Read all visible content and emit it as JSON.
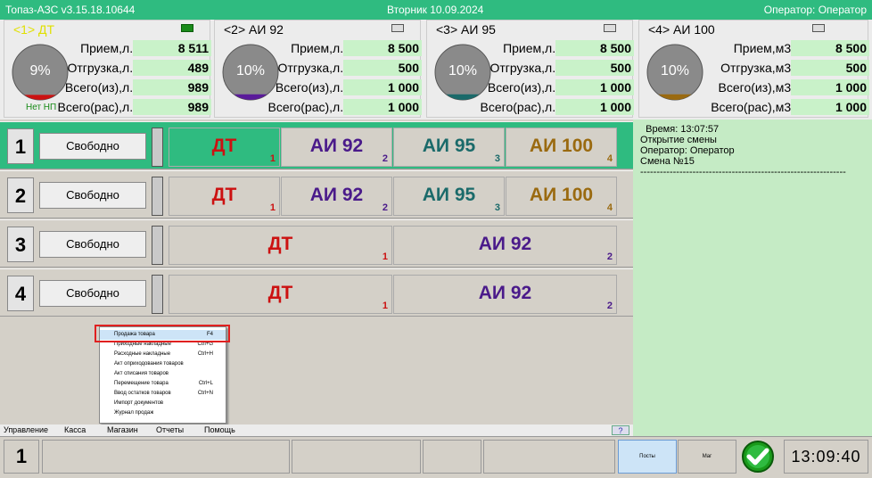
{
  "titlebar": {
    "app": "Топаз-АЗС  v3.15.18.10644",
    "date": "Вторник 10.09.2024",
    "operator": "Оператор: Оператор"
  },
  "tanks": [
    {
      "name": "<1> ДТ",
      "name_color": "#e0e000",
      "indicator_on": true,
      "percent": "9%",
      "fill": 0.09,
      "fill_color": "#cc1111",
      "nonp": "Нет НП",
      "labels": [
        "Прием,л.:",
        "Отгрузка,л.:",
        "Всего(из),л.:",
        "Всего(рас),л.:"
      ],
      "values": [
        "8 511",
        "489",
        "989",
        "989"
      ]
    },
    {
      "name": "<2> АИ 92",
      "name_color": "#000000",
      "indicator_on": false,
      "percent": "10%",
      "fill": 0.1,
      "fill_color": "#5a1a9a",
      "nonp": "",
      "labels": [
        "Прием,л.:",
        "Отгрузка,л.:",
        "Всего(из),л.:",
        "Всего(рас),л.:"
      ],
      "values": [
        "8 500",
        "500",
        "1 000",
        "1 000"
      ]
    },
    {
      "name": "<3> АИ 95",
      "name_color": "#000000",
      "indicator_on": false,
      "percent": "10%",
      "fill": 0.1,
      "fill_color": "#1a6a6a",
      "nonp": "",
      "labels": [
        "Прием,л.:",
        "Отгрузка,л.:",
        "Всего(из),л.:",
        "Всего(рас),л.:"
      ],
      "values": [
        "8 500",
        "500",
        "1 000",
        "1 000"
      ]
    },
    {
      "name": "<4> АИ 100",
      "name_color": "#000000",
      "indicator_on": false,
      "percent": "10%",
      "fill": 0.1,
      "fill_color": "#9a6a10",
      "nonp": "",
      "labels": [
        "Прием,м3:",
        "Отгрузка,м3:",
        "Всего(из),м3:",
        "Всего(рас),м3:"
      ],
      "values": [
        "8 500",
        "500",
        "1 000",
        "1 000"
      ]
    }
  ],
  "posts": [
    {
      "num": "1",
      "state": "Свободно",
      "active": true,
      "nozzles": [
        {
          "fuel": "ДТ",
          "n": "1",
          "color": "#cc1111",
          "active": true
        },
        {
          "fuel": "АИ 92",
          "n": "2",
          "color": "#4a1a8a"
        },
        {
          "fuel": "АИ 95",
          "n": "3",
          "color": "#1a6a6a"
        },
        {
          "fuel": "АИ 100",
          "n": "4",
          "color": "#9a6a10"
        }
      ]
    },
    {
      "num": "2",
      "state": "Свободно",
      "active": false,
      "nozzles": [
        {
          "fuel": "ДТ",
          "n": "1",
          "color": "#cc1111"
        },
        {
          "fuel": "АИ 92",
          "n": "2",
          "color": "#4a1a8a"
        },
        {
          "fuel": "АИ 95",
          "n": "3",
          "color": "#1a6a6a"
        },
        {
          "fuel": "АИ 100",
          "n": "4",
          "color": "#9a6a10"
        }
      ]
    },
    {
      "num": "3",
      "state": "Свободно",
      "active": false,
      "nozzles": [
        {
          "fuel": "ДТ",
          "n": "1",
          "color": "#cc1111"
        },
        {
          "fuel": "АИ 92",
          "n": "2",
          "color": "#4a1a8a"
        }
      ]
    },
    {
      "num": "4",
      "state": "Свободно",
      "active": false,
      "nozzles": [
        {
          "fuel": "ДТ",
          "n": "1",
          "color": "#cc1111"
        },
        {
          "fuel": "АИ 92",
          "n": "2",
          "color": "#4a1a8a"
        }
      ]
    }
  ],
  "log": [
    "  Время: 13:07:57",
    "Открытие смены",
    "Оператор: Оператор",
    "Смена №15",
    "---------------------------------------------------------------"
  ],
  "menu": [
    {
      "label": "Продажа товара",
      "shortcut": "F4",
      "highlighted": true
    },
    {
      "label": "Приходные накладные",
      "shortcut": "Ctrl+G"
    },
    {
      "label": "Расходные накладные",
      "shortcut": "Ctrl+H"
    },
    {
      "label": "Акт оприходования товаров",
      "shortcut": ""
    },
    {
      "label": "Акт списания товаров",
      "shortcut": ""
    },
    {
      "label": "Перемещение товара",
      "shortcut": "Ctrl+L"
    },
    {
      "label": "Ввод остатков товаров",
      "shortcut": "Ctrl+N"
    },
    {
      "label": "Импорт документов",
      "shortcut": ""
    },
    {
      "label": "Журнал продаж",
      "shortcut": ""
    }
  ],
  "menubar": {
    "items": [
      "Управление",
      "Касса",
      "Магазин",
      "Отчеты",
      "Помощь"
    ],
    "help": "?"
  },
  "bottom": {
    "post_num": "1",
    "tab_posts": "Посты",
    "tab_shop": "Маг",
    "clock": "13:09:40"
  }
}
